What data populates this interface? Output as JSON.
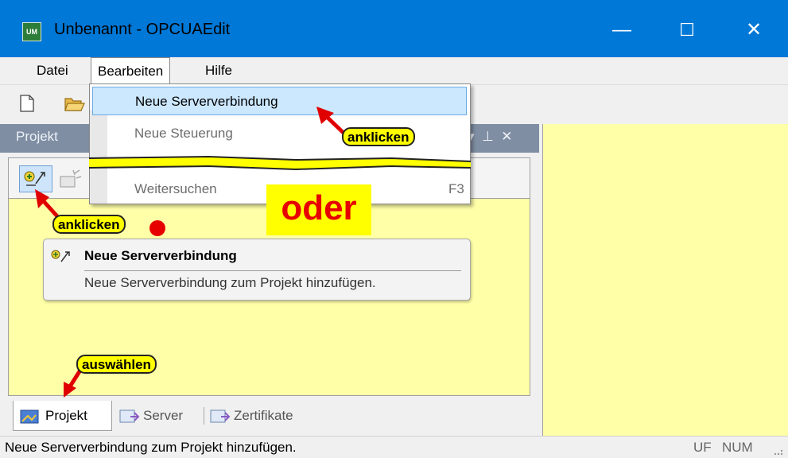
{
  "window": {
    "title": "Unbenannt - OPCUAEdit",
    "app_icon_label": "UM",
    "minimize_glyph": "—",
    "maximize_glyph": "☐",
    "close_glyph": "✕"
  },
  "menubar": {
    "items": [
      "Datei",
      "Bearbeiten",
      "Hilfe"
    ]
  },
  "dropdown": {
    "items": [
      {
        "label": "Neue Serververbindung",
        "shortcut": "",
        "state": "highlighted"
      },
      {
        "label": "Neue Steuerung",
        "shortcut": "",
        "state": "disabled"
      },
      {
        "label": "Weitersuchen",
        "shortcut": "F3",
        "state": "disabled"
      }
    ]
  },
  "panel": {
    "title": "Projekt",
    "header_glyphs": "▾  ⊥  ✕"
  },
  "tooltip": {
    "title": "Neue Serververbindung",
    "description": "Neue Serververbindung zum Projekt hinzufügen."
  },
  "tabs": [
    {
      "label": "Projekt",
      "active": true
    },
    {
      "label": "Server",
      "active": false
    },
    {
      "label": "Zertifikate",
      "active": false
    }
  ],
  "statusbar": {
    "message": "Neue Serververbindung zum Projekt hinzufügen.",
    "indicator_1": "UF",
    "indicator_2": "NUM"
  },
  "annotations": {
    "anklicken_menu": "anklicken",
    "anklicken_toolbar": "anklicken",
    "auswaehlen": "auswählen",
    "oder": "oder"
  },
  "colors": {
    "titlebar": "#0078d7",
    "panel_background": "#ffffa8",
    "panel_header": "#7f8ea3",
    "menu_highlight": "#cce8ff",
    "callout": "#ffff00",
    "arrow": "#e00000",
    "oder_text": "#e60000"
  }
}
